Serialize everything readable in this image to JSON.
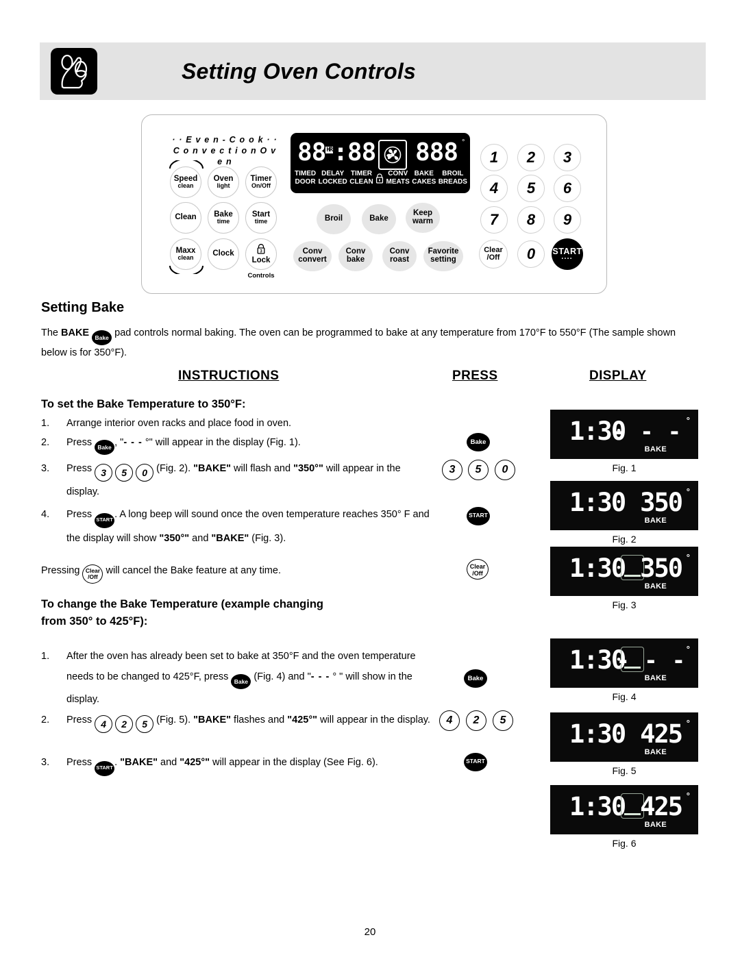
{
  "header": {
    "title": "Setting Oven Controls",
    "icon": "hand-pressing-button-icon"
  },
  "control_panel": {
    "brand_line1": "· · E v e n - C o o k · ·",
    "brand_line2": "C o n v e c t i o n   O v e n",
    "left_keys": [
      {
        "main": "Speed",
        "sub": "clean"
      },
      {
        "main": "Oven",
        "sub": "light"
      },
      {
        "main": "Timer",
        "sub": "On/Off"
      },
      {
        "main": "Clean",
        "sub": ""
      },
      {
        "main": "Bake",
        "sub": "time"
      },
      {
        "main": "Start",
        "sub": "time"
      },
      {
        "main": "Maxx",
        "sub": "clean"
      },
      {
        "main": "Clock",
        "sub": ""
      },
      {
        "main": "Lock",
        "sub": ""
      }
    ],
    "lock_caption": "Controls",
    "function_keys": [
      {
        "main": "Broil",
        "sub": ""
      },
      {
        "main": "Bake",
        "sub": ""
      },
      {
        "main": "Keep",
        "sub": "warm"
      },
      {
        "main": "Conv",
        "sub": "convert"
      },
      {
        "main": "Conv",
        "sub": "bake"
      },
      {
        "main": "Conv",
        "sub": "roast"
      },
      {
        "main": "Favorite",
        "sub": "setting"
      }
    ],
    "keypad": [
      "1",
      "2",
      "3",
      "4",
      "5",
      "6",
      "7",
      "8",
      "9"
    ],
    "clear_top": "Clear",
    "clear_bottom": "/Off",
    "zero": "0",
    "start": "START",
    "display": {
      "time_left": "88",
      "hr_indicator": "HR",
      "time_right": "88",
      "temp": "888",
      "degree": "°",
      "fan_icon": "convection-fan-icon",
      "indicator_top": [
        "TIMED",
        "DELAY",
        "TIMER",
        "",
        "CONV",
        "BAKE",
        "BROIL"
      ],
      "indicator_bottom": [
        "DOOR",
        "LOCKED",
        "CLEAN",
        "",
        "MEATS",
        "CAKES",
        "BREADS"
      ],
      "lock_icon": "padlock-icon"
    }
  },
  "setting_bake": {
    "heading": "Setting Bake",
    "intro_before": "The ",
    "intro_bold": "BAKE",
    "intro_after": " pad controls normal baking. The oven can be programmed to bake at any temperature from 170°F to 550°F (The sample shown below is for 350°F).",
    "pad_bake_label": "Bake"
  },
  "columns": {
    "instructions": "INSTRUCTIONS",
    "press": "PRESS",
    "display": "DISPLAY"
  },
  "section1": {
    "subhead": "To set the Bake Temperature to 350°F:",
    "steps": [
      {
        "num": "1.",
        "text": "Arrange interior oven racks and place food in oven."
      },
      {
        "num": "2.",
        "text": "Press ___PAD_BAKE___, \"- - - °\" will appear in the display (Fig. 1)."
      },
      {
        "num": "3.",
        "text": "Press ___PAD_3___ ___PAD_5___ ___PAD_0___ (Fig. 2). \"BAKE\" will flash and \"350°\" will appear in the display."
      },
      {
        "num": "4.",
        "text": "Press ___PAD_START___. A long beep will sound once the oven temperature reaches 350° F and the display will show \"350°\" and \"BAKE\" (Fig. 3)."
      }
    ],
    "cancel_note": "Pressing ___PAD_CLEAR___ will cancel the Bake feature at any time.",
    "press_items": [
      "Bake",
      "3",
      "5",
      "0",
      "START",
      "Clear /Off"
    ]
  },
  "section2": {
    "subhead_line1": "To change the Bake Temperature (example changing",
    "subhead_line2": "from 350° to 425°F):",
    "steps": [
      {
        "num": "1.",
        "text": "After the oven has already been set to bake at 350°F and the oven temperature needs to be changed to 425°F, press ___PAD_BAKE___ (Fig. 4) and \"- - - ° \" will show in the display."
      },
      {
        "num": "2.",
        "text": "Press ___PAD_4___ ___PAD_2___ ___PAD_5___ (Fig. 5). \"BAKE\" flashes and \"425°\" will appear in the display."
      },
      {
        "num": "3.",
        "text": "Press ___PAD_START___. \"BAKE\" and \"425°\" will appear in the display (See Fig. 6)."
      }
    ],
    "press_items": [
      "Bake",
      "4",
      "2",
      "5",
      "START"
    ]
  },
  "figures": [
    {
      "caption": "Fig. 1",
      "time": "1:30",
      "temp": "- - -",
      "temp_is_dash": true,
      "has_icon": false,
      "degree": "°",
      "bake": "BAKE"
    },
    {
      "caption": "Fig. 2",
      "time": "1:30",
      "temp": "350",
      "temp_is_dash": false,
      "has_icon": false,
      "degree": "°",
      "bake": "BAKE"
    },
    {
      "caption": "Fig. 3",
      "time": "1:30",
      "temp": "350",
      "temp_is_dash": false,
      "has_icon": true,
      "degree": "°",
      "bake": "BAKE"
    },
    {
      "caption": "Fig. 4",
      "time": "1:30",
      "temp": "- - -",
      "temp_is_dash": true,
      "has_icon": true,
      "degree": "°",
      "bake": "BAKE"
    },
    {
      "caption": "Fig. 5",
      "time": "1:30",
      "temp": "425",
      "temp_is_dash": false,
      "has_icon": false,
      "degree": "°",
      "bake": "BAKE"
    },
    {
      "caption": "Fig. 6",
      "time": "1:30",
      "temp": "425",
      "temp_is_dash": false,
      "has_icon": true,
      "degree": "°",
      "bake": "BAKE"
    }
  ],
  "page_number": "20",
  "colors": {
    "header_bg": "#e3e3e3",
    "display_bg": "#000000",
    "key_gray": "#e6e6e6"
  }
}
